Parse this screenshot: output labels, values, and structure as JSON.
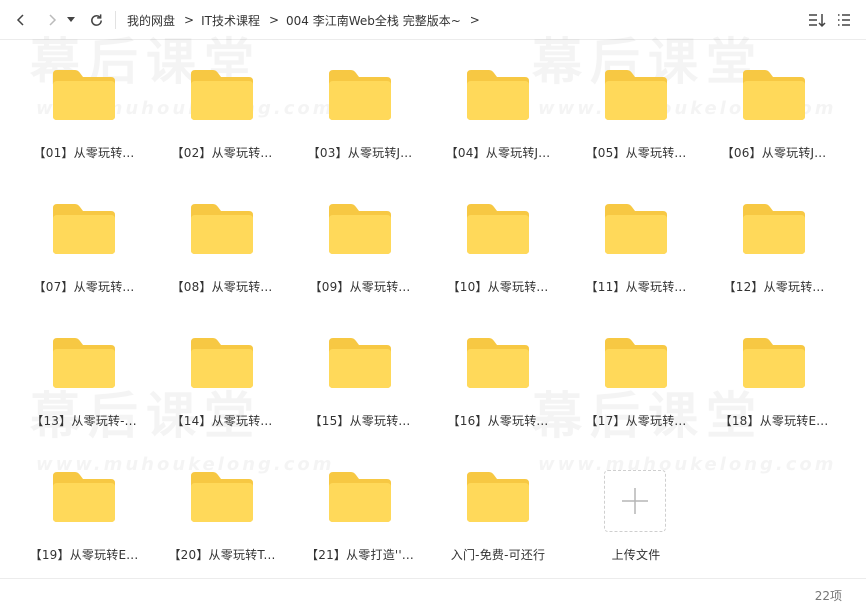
{
  "breadcrumb": {
    "items": [
      "我的网盘",
      "IT技术课程",
      "004 李江南Web全栈 完整版本~"
    ],
    "separator": ">"
  },
  "watermark": {
    "title": "幕后课堂",
    "url": "www.muhoukelong.com"
  },
  "folders": [
    {
      "label": "【01】从零玩转..."
    },
    {
      "label": "【02】从零玩转..."
    },
    {
      "label": "【03】从零玩转J..."
    },
    {
      "label": "【04】从零玩转J..."
    },
    {
      "label": "【05】从零玩转..."
    },
    {
      "label": "【06】从零玩转J..."
    },
    {
      "label": "【07】从零玩转..."
    },
    {
      "label": "【08】从零玩转..."
    },
    {
      "label": "【09】从零玩转..."
    },
    {
      "label": "【10】从零玩转..."
    },
    {
      "label": "【11】从零玩转..."
    },
    {
      "label": "【12】从零玩转..."
    },
    {
      "label": "【13】从零玩转-..."
    },
    {
      "label": "【14】从零玩转..."
    },
    {
      "label": "【15】从零玩转..."
    },
    {
      "label": "【16】从零玩转..."
    },
    {
      "label": "【17】从零玩转..."
    },
    {
      "label": "【18】从零玩转E..."
    },
    {
      "label": "【19】从零玩转E..."
    },
    {
      "label": "【20】从零玩转T..."
    },
    {
      "label": "【21】从零打造''..."
    },
    {
      "label": "入门-免费-可还行"
    }
  ],
  "upload": {
    "label": "上传文件"
  },
  "footer": {
    "count": "22项"
  },
  "colors": {
    "folder_back": "#f7c843",
    "folder_front": "#ffd95a",
    "text": "#333333"
  },
  "icons": {
    "back": "chevron-left-icon",
    "forward": "chevron-right-icon",
    "dropdown": "caret-down-icon",
    "refresh": "refresh-icon",
    "sort": "sort-icon",
    "view": "list-view-icon",
    "upload": "plus-icon"
  }
}
